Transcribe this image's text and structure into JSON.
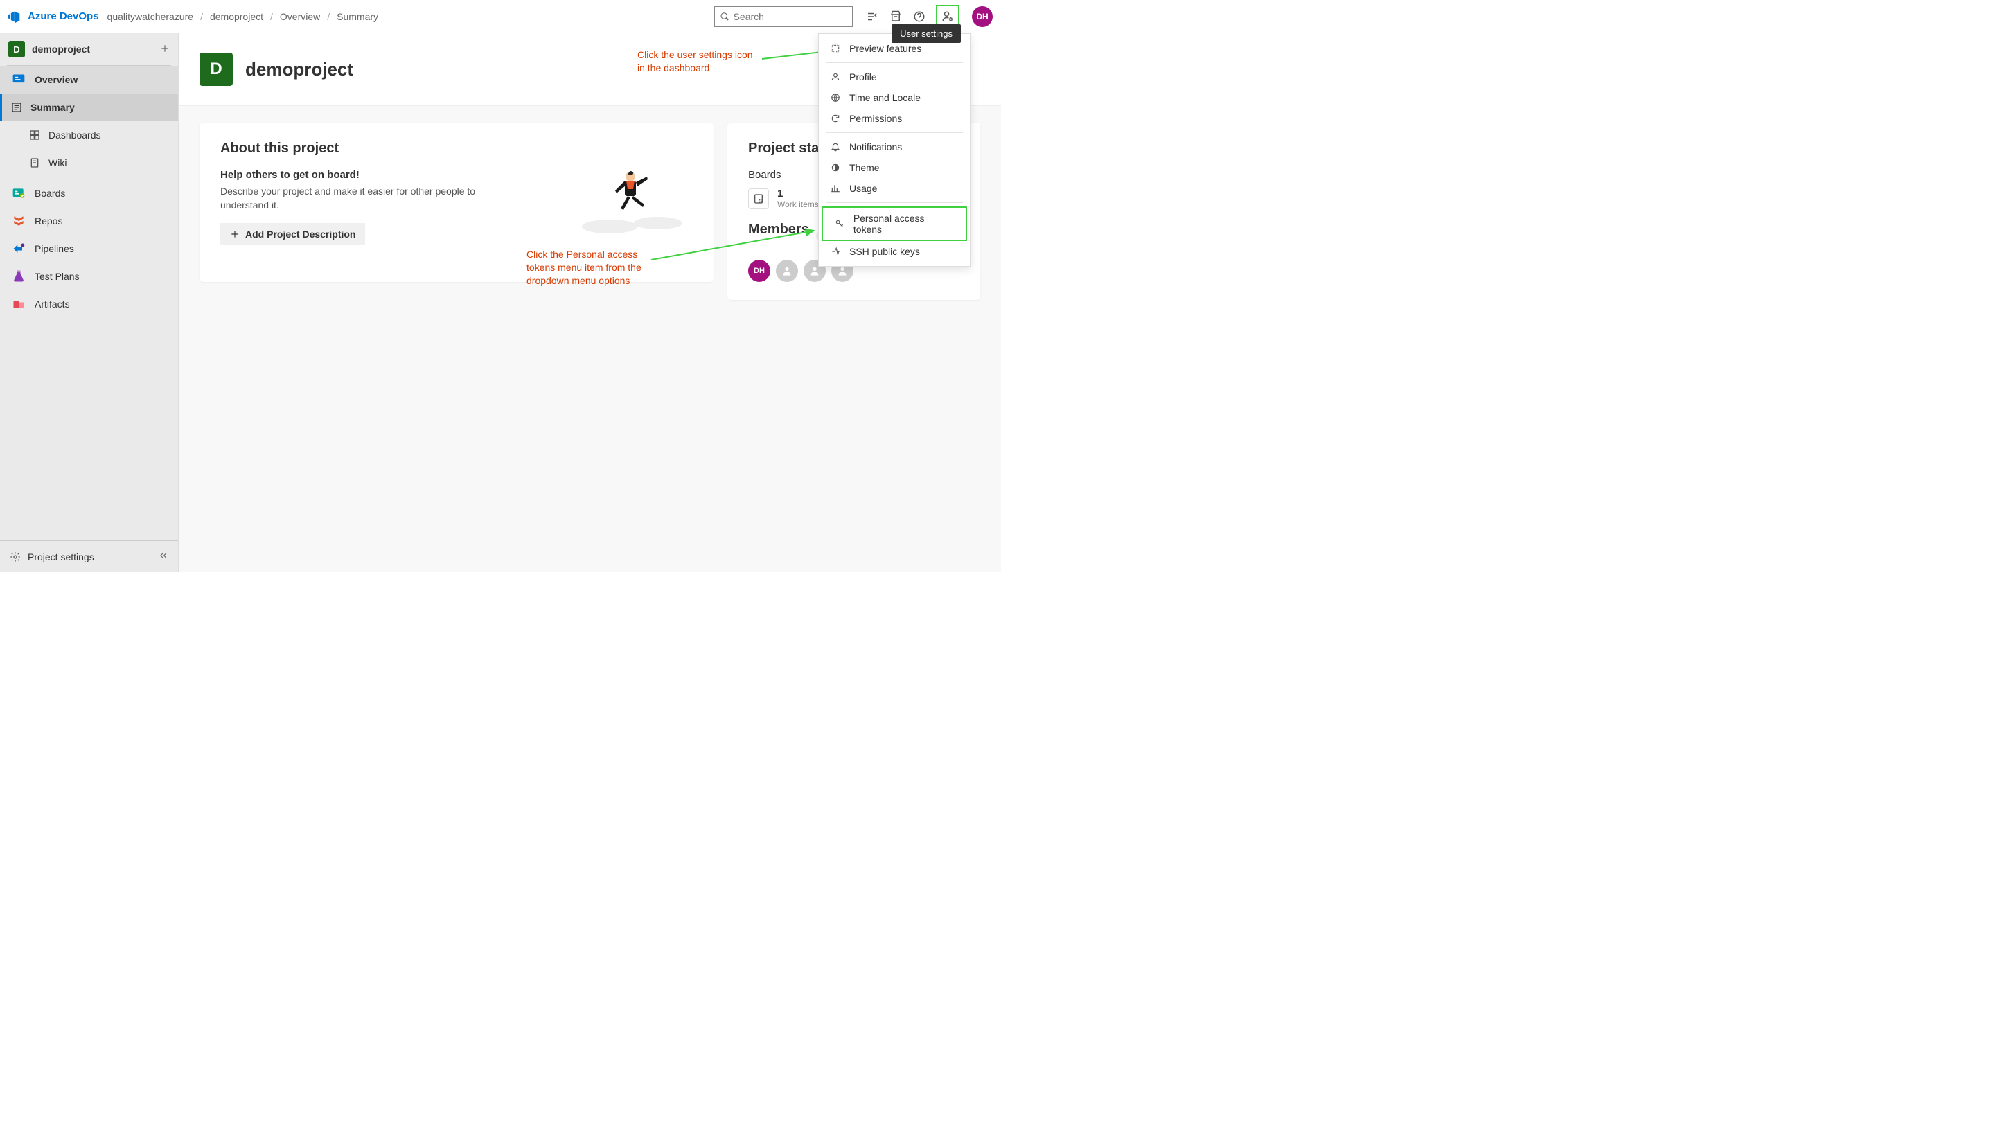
{
  "header": {
    "brand": "Azure DevOps",
    "crumbs": [
      "qualitywatcherazure",
      "demoproject",
      "Overview",
      "Summary"
    ],
    "search_placeholder": "Search",
    "tooltip": "User settings",
    "avatar_initials": "DH"
  },
  "sidebar": {
    "project": {
      "initial": "D",
      "name": "demoproject"
    },
    "overview_label": "Overview",
    "overview_children": [
      "Summary",
      "Dashboards",
      "Wiki"
    ],
    "items": [
      "Boards",
      "Repos",
      "Pipelines",
      "Test Plans",
      "Artifacts"
    ],
    "footer": "Project settings"
  },
  "main": {
    "project_initial": "D",
    "project_title": "demoproject",
    "about_title": "About this project",
    "about_subtitle": "Help others to get on board!",
    "about_desc": "Describe your project and make it easier for other people to understand it.",
    "add_desc_btn": "Add Project Description",
    "stats_title": "Project stats",
    "stats_section": "Boards",
    "stat_number": "1",
    "stat_sub": "Work items created",
    "members_title": "Members",
    "members_count": "4",
    "member_initials": "DH"
  },
  "dropdown": {
    "group1": [
      "Preview features"
    ],
    "group2": [
      "Profile",
      "Time and Locale",
      "Permissions"
    ],
    "group3": [
      "Notifications",
      "Theme",
      "Usage"
    ],
    "group4": [
      "Personal access tokens",
      "SSH public keys"
    ]
  },
  "annotations": {
    "a1": "Click the user settings icon in the dashboard",
    "a2": "Click the Personal access tokens menu item from the dropdown menu options"
  }
}
